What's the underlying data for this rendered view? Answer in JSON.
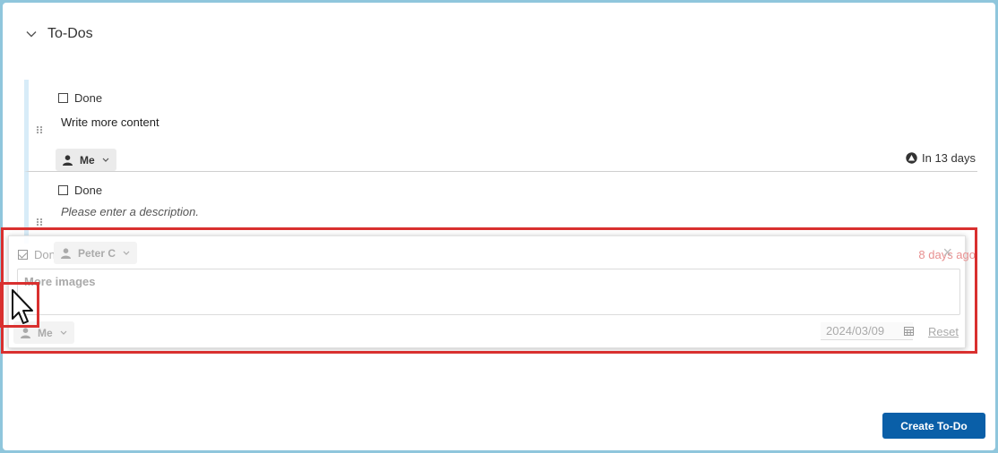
{
  "section": {
    "title": "To-Dos"
  },
  "todos": [
    {
      "done_label": "Done",
      "title": "Write more content",
      "assignee": "Me",
      "due": "In 13 days"
    },
    {
      "done_label": "Done",
      "description_placeholder": "Please enter a description."
    }
  ],
  "ghost": {
    "done_label": "Done",
    "assignee_peter": "Peter C",
    "time_ago": "8 days ago",
    "textarea_value": "More images",
    "assignee_me": "Me",
    "date": "2024/03/09",
    "reset_label": "Reset"
  },
  "actions": {
    "create_label": "Create To-Do"
  },
  "colors": {
    "accent": "#0a5fa8",
    "highlight": "#d9302f",
    "overdue": "#e89090"
  }
}
